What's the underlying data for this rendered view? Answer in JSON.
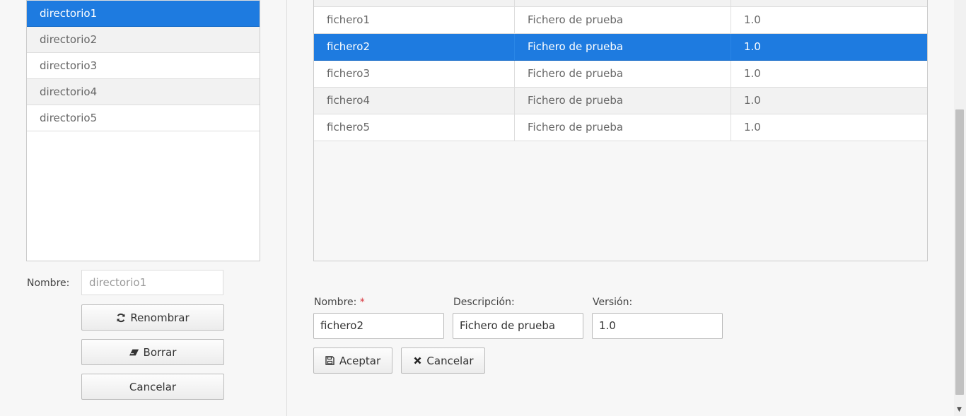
{
  "directories": {
    "items": [
      {
        "label": "directorio1",
        "selected": true
      },
      {
        "label": "directorio2",
        "selected": false
      },
      {
        "label": "directorio3",
        "selected": false
      },
      {
        "label": "directorio4",
        "selected": false
      },
      {
        "label": "directorio5",
        "selected": false
      }
    ],
    "name_label": "Nombre:",
    "name_value": "directorio1",
    "rename_label": "Renombrar",
    "delete_label": "Borrar",
    "cancel_label": "Cancelar"
  },
  "files": {
    "rows": [
      {
        "name": "fichero1",
        "description": "Fichero de prueba",
        "version": "1.0",
        "selected": false
      },
      {
        "name": "fichero2",
        "description": "Fichero de prueba",
        "version": "1.0",
        "selected": true
      },
      {
        "name": "fichero3",
        "description": "Fichero de prueba",
        "version": "1.0",
        "selected": false
      },
      {
        "name": "fichero4",
        "description": "Fichero de prueba",
        "version": "1.0",
        "selected": false
      },
      {
        "name": "fichero5",
        "description": "Fichero de prueba",
        "version": "1.0",
        "selected": false
      }
    ]
  },
  "form": {
    "name_label": "Nombre:",
    "required_mark": "*",
    "description_label": "Descripción:",
    "version_label": "Versión:",
    "name_value": "fichero2",
    "description_value": "Fichero de prueba",
    "version_value": "1.0",
    "accept_label": "Aceptar",
    "cancel_label": "Cancelar"
  },
  "colors": {
    "selection": "#1e7be0"
  }
}
